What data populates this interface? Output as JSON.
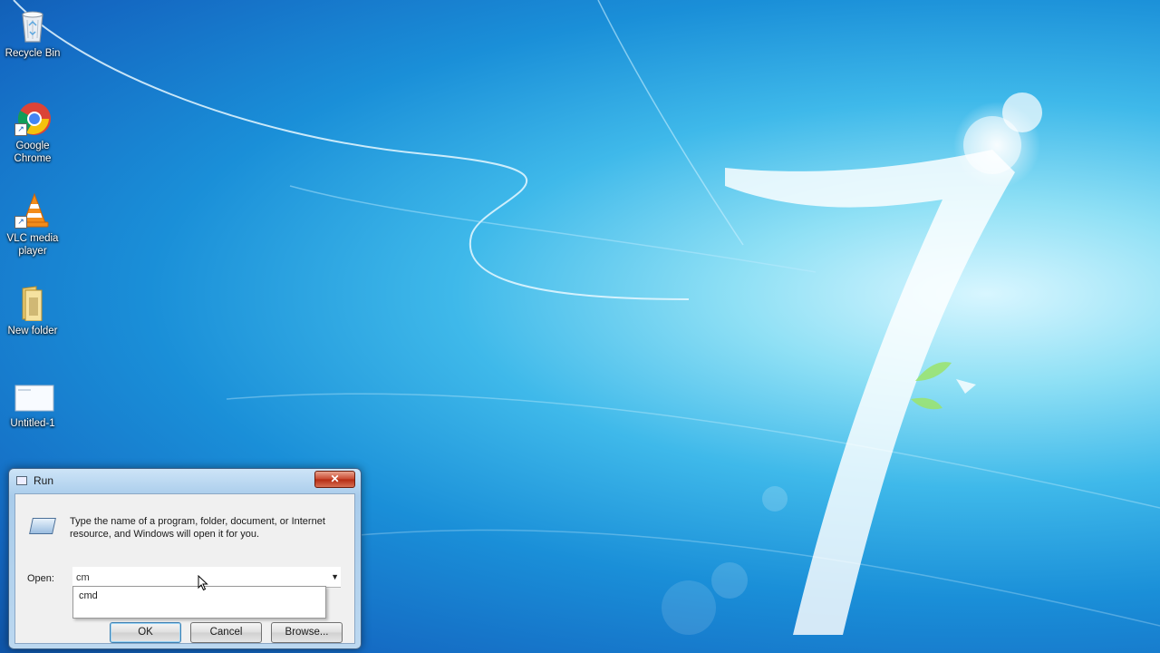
{
  "desktop": {
    "icons": [
      {
        "label": "Recycle Bin",
        "icon": "recycle-bin-icon"
      },
      {
        "label": "Google Chrome",
        "icon": "chrome-icon"
      },
      {
        "label": "VLC media player",
        "icon": "vlc-icon"
      },
      {
        "label": "New folder",
        "icon": "folder-icon"
      },
      {
        "label": "Untitled-1",
        "icon": "document-icon"
      }
    ]
  },
  "run_dialog": {
    "title": "Run",
    "close_label": "✕",
    "description": "Type the name of a program, folder, document, or Internet resource, and Windows will open it for you.",
    "open_label": "Open:",
    "open_value": "cm",
    "autocomplete": [
      "cmd"
    ],
    "buttons": {
      "ok": "OK",
      "cancel": "Cancel",
      "browse": "Browse..."
    }
  }
}
